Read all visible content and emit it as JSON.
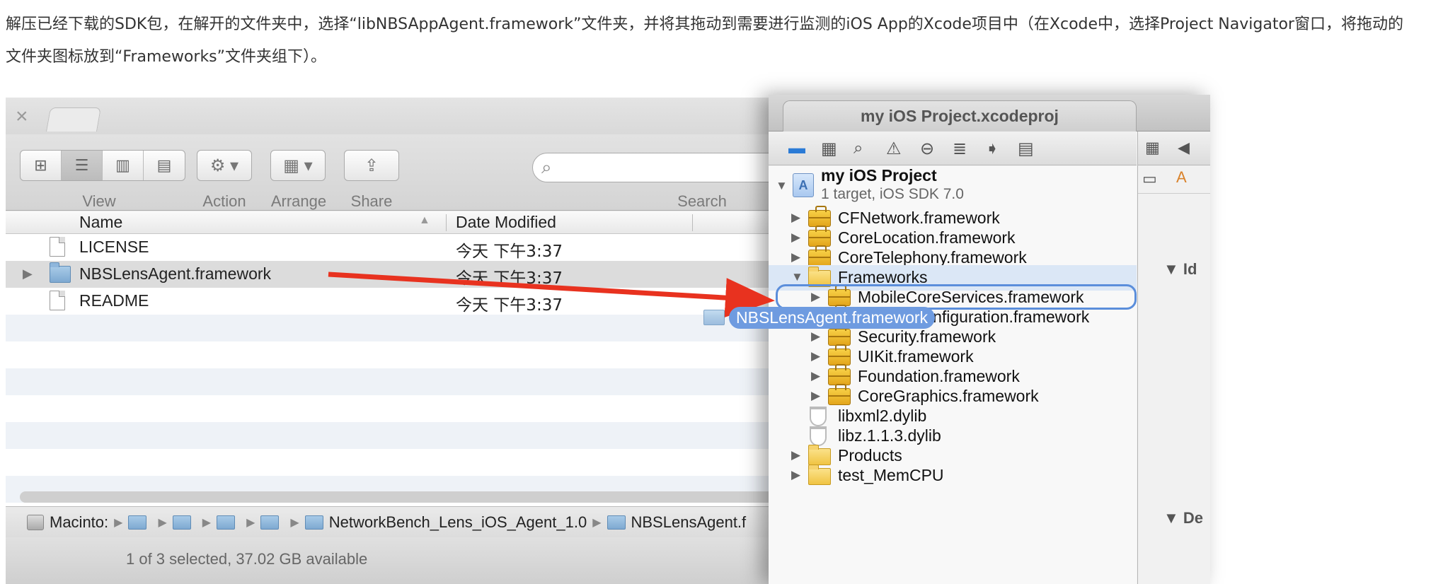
{
  "intro_text": "解压已经下载的SDK包，在解开的文件夹中，选择“libNBSAppAgent.framework”文件夹，并将其拖动到需要进行监测的iOS App的Xcode项目中（在Xcode中，选择Project Navigator窗口，将拖动的文件夹图标放到“Frameworks”文件夹组下）。",
  "finder": {
    "toolbar": {
      "view_label": "View",
      "action_label": "Action",
      "arrange_label": "Arrange",
      "share_label": "Share",
      "search_label": "Search"
    },
    "columns": {
      "name": "Name",
      "date": "Date Modified"
    },
    "files": [
      {
        "name": "LICENSE",
        "date": "今天 下午3:37",
        "kind": "file",
        "selected": false
      },
      {
        "name": "NBSLensAgent.framework",
        "date": "今天 下午3:37",
        "kind": "folder",
        "selected": true
      },
      {
        "name": "README",
        "date": "今天 下午3:37",
        "kind": "file",
        "selected": false
      }
    ],
    "path": {
      "disk": "Macinto:",
      "folder1": "NetworkBench_Lens_iOS_Agent_1.0",
      "folder2": "NBSLensAgent.f"
    },
    "status": "1 of 3 selected, 37.02 GB available"
  },
  "xcode": {
    "window_title": "my iOS Project.xcodeproj",
    "project": {
      "name": "my iOS Project",
      "subtitle": "1 target, iOS SDK 7.0"
    },
    "tree": {
      "cfnetwork": "CFNetwork.framework",
      "corelocation": "CoreLocation.framework",
      "coretelephony": "CoreTelephony.framework",
      "frameworks": "Frameworks",
      "mobilecoreservices": "MobileCoreServices.framework",
      "systemconfiguration": "SystemConfiguration.framework",
      "security": "Security.framework",
      "uikit": "UIKit.framework",
      "foundation": "Foundation.framework",
      "coregraphics": "CoreGraphics.framework",
      "libxml2": "libxml2.dylib",
      "libz": "libz.1.1.3.dylib",
      "products": "Products",
      "testmemcpu": "test_MemCPU"
    },
    "utility": {
      "section1": "Id",
      "section2": "De"
    }
  },
  "drag_ghost_label": "NBSLensAgent.framework",
  "colors": {
    "arrow": "#e8321f",
    "selection_ring": "#5b8edb",
    "ghost_label_bg": "#6e9be0"
  }
}
